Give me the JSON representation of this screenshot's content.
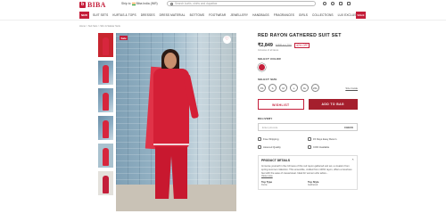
{
  "header": {
    "logo_text": "BIBA",
    "ship_to": "Ship to",
    "country": "Biba India (INR)",
    "search_placeholder": "Search kurtis, shirts and dupattas"
  },
  "nav": {
    "left_badge": "NEW",
    "right_badge": "SALE",
    "items": [
      "SUIT SETS",
      "KURTAS & TOPS",
      "DRESSES",
      "DRESS MATERIAL",
      "BOTTOMS",
      "FOOTWEAR",
      "JEWELLERY",
      "HANDBAGS",
      "FRAGRANCES",
      "GIRLS",
      "COLLECTIONS",
      "LUX EXCLUSIVE"
    ]
  },
  "breadcrumb": "Home > Suit Sets > Slim & Salwar Suits",
  "image": {
    "sale_tag": "Sale"
  },
  "product": {
    "title": "RED RAYON GATHERED SUIT SET",
    "price": "₹2,849",
    "mrp": "MRP ₹4,750",
    "discount": "40% OFF",
    "tax_note": "Inclusive of all taxes",
    "select_color_label": "SELECT COLOR",
    "select_size_label": "SELECT SIZE",
    "sizes": [
      "XS",
      "S",
      "M",
      "L",
      "XL",
      "2XL"
    ],
    "size_guide": "Size Guide",
    "wishlist_label": "WISHLIST",
    "add_to_bag_label": "ADD TO BAG",
    "delivery_label": "DELIVERY",
    "pincode_placeholder": "Enter pincode",
    "check_label": "CHECK",
    "features": [
      "Free Shipping",
      "15 Days Easy Return",
      "Assured Quality",
      "COD Available"
    ],
    "details_title": "PRODUCT DETAILS",
    "details_text": "Immerse yourself in the richness of this red rayon gathered suit set, a creation from spring summer collection. This ensemble, crafted from 100% rayon, offers a luxurious feel with the ease of casual wear. Ideal for women who adore...",
    "view_more": "View more",
    "attributes": [
      {
        "k": "Top Type",
        "v": "Kurta"
      },
      {
        "k": "Top Style",
        "v": "Gathered"
      }
    ]
  },
  "colors": {
    "accent": "#c41e3a",
    "button_dark": "#a51f2d",
    "swatch": "#c41e3a"
  }
}
